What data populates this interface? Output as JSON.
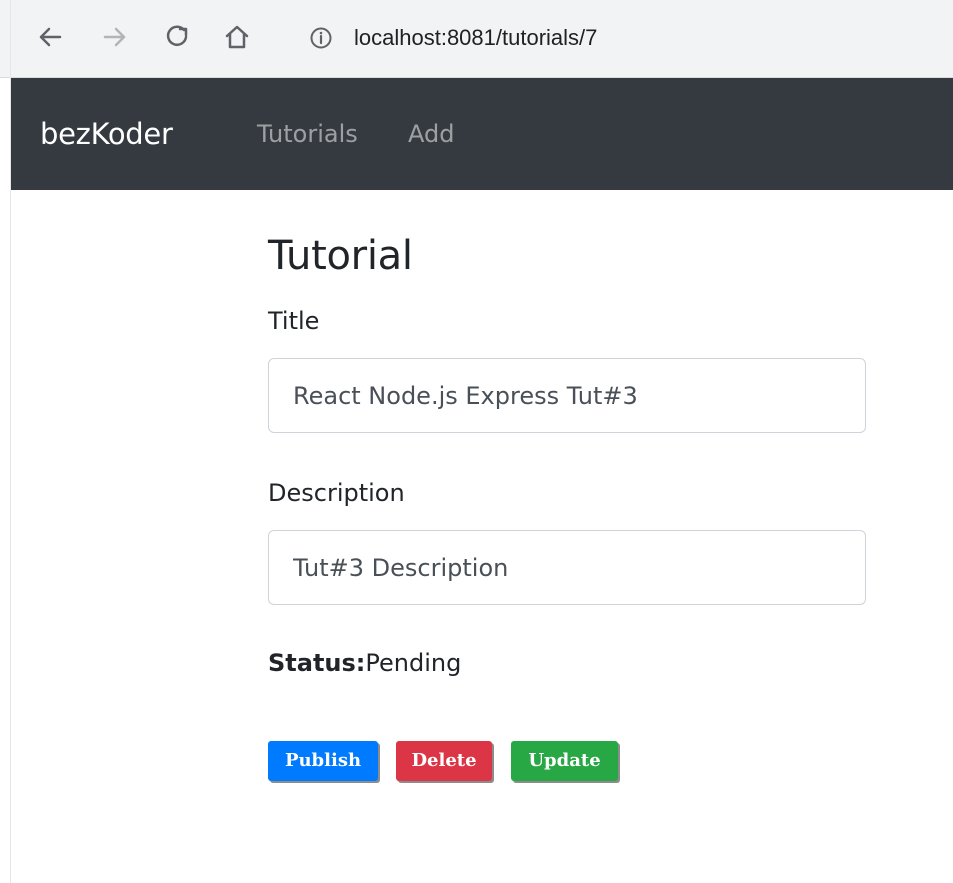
{
  "browser": {
    "url": "localhost:8081/tutorials/7",
    "icons": [
      "back-arrow-icon",
      "forward-arrow-icon",
      "reload-icon",
      "home-icon",
      "info-icon"
    ]
  },
  "navbar": {
    "brand": "bezKoder",
    "links": [
      "Tutorials",
      "Add"
    ],
    "background": "#343a40"
  },
  "tutorial": {
    "heading": "Tutorial",
    "title_label": "Title",
    "title_value": "React Node.js Express Tut#3",
    "description_label": "Description",
    "description_value": "Tut#3 Description",
    "status_label": "Status:",
    "status_value": "Pending"
  },
  "actions": {
    "publish": "Publish",
    "delete": "Delete",
    "update": "Update",
    "colors": {
      "publish": "#007bff",
      "delete": "#dc3545",
      "update": "#28a745"
    }
  }
}
